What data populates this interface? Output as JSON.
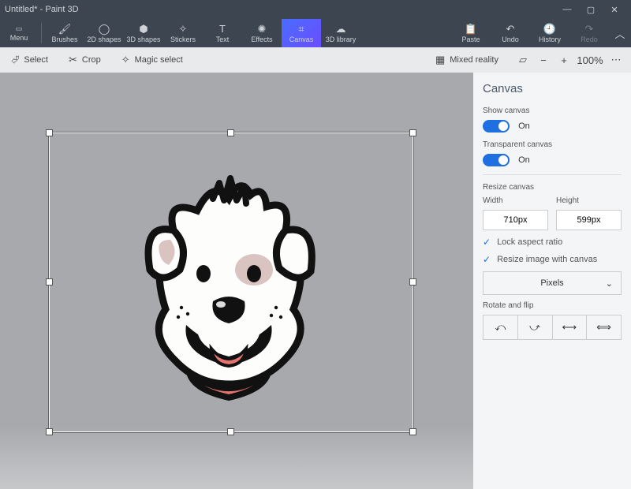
{
  "titlebar": {
    "title": "Untitled* - Paint 3D"
  },
  "ribbon": {
    "menu": "Menu",
    "tools": [
      {
        "id": "brushes",
        "label": "Brushes"
      },
      {
        "id": "2dshapes",
        "label": "2D shapes"
      },
      {
        "id": "3dshapes",
        "label": "3D shapes"
      },
      {
        "id": "stickers",
        "label": "Stickers"
      },
      {
        "id": "text",
        "label": "Text"
      },
      {
        "id": "effects",
        "label": "Effects"
      },
      {
        "id": "canvas",
        "label": "Canvas",
        "active": true
      },
      {
        "id": "3dlibrary",
        "label": "3D library"
      }
    ],
    "right": [
      {
        "id": "paste",
        "label": "Paste"
      },
      {
        "id": "undo",
        "label": "Undo"
      },
      {
        "id": "history",
        "label": "History"
      },
      {
        "id": "redo",
        "label": "Redo"
      }
    ]
  },
  "toolbar": {
    "select": "Select",
    "crop": "Crop",
    "magic": "Magic select",
    "mixed": "Mixed reality",
    "zoom": "100%"
  },
  "side": {
    "title": "Canvas",
    "show_canvas_label": "Show canvas",
    "show_canvas_state": "On",
    "transparent_label": "Transparent canvas",
    "transparent_state": "On",
    "resize_label": "Resize canvas",
    "width_label": "Width",
    "height_label": "Height",
    "width_value": "710px",
    "height_value": "599px",
    "lock_label": "Lock aspect ratio",
    "resize_with_label": "Resize image with canvas",
    "units": "Pixels",
    "rotate_label": "Rotate and flip"
  }
}
